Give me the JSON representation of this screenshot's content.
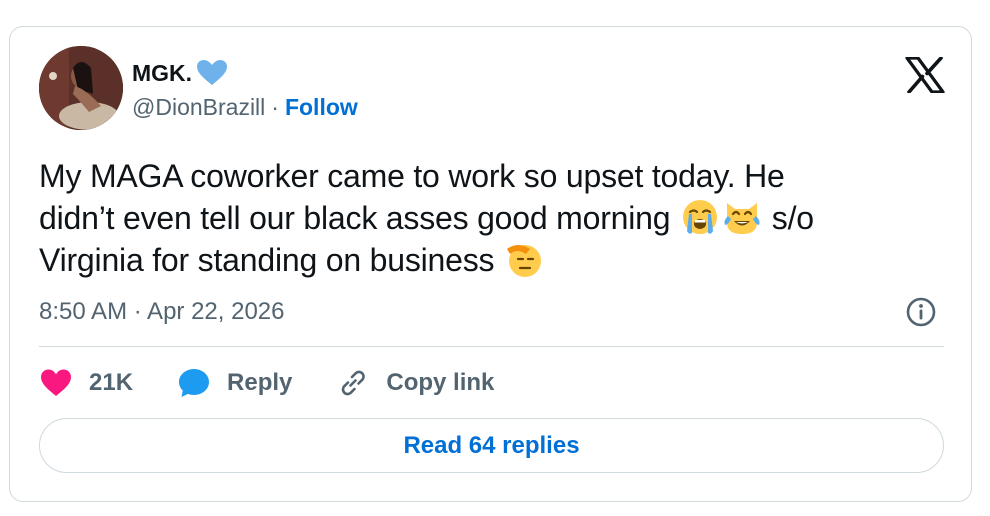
{
  "author": {
    "display_name": "MGK.",
    "handle": "@DionBrazill",
    "separator": "·",
    "follow_label": "Follow"
  },
  "tweet": {
    "lines": [
      "My MAGA coworker came to work so upset today. He",
      "didn’t even tell our black asses good morning",
      "s/o",
      "Virginia for standing on business"
    ],
    "emojis": [
      "loudly-crying-face",
      "cat-with-tears-of-joy",
      "saluting-face"
    ],
    "timestamp": "8:50 AM · Apr 22, 2026"
  },
  "actions": {
    "like_count": "21K",
    "reply_label": "Reply",
    "copy_link_label": "Copy link"
  },
  "footer": {
    "read_replies_label": "Read 64 replies"
  },
  "colors": {
    "accent": "#006fd6",
    "like": "#f91880",
    "verified": "#6fb1ea",
    "muted": "#536471",
    "border": "#cfd9de"
  }
}
